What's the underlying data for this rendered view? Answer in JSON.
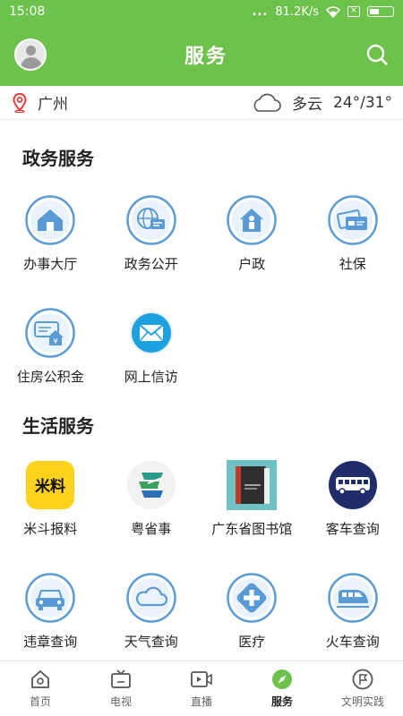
{
  "status_bar": {
    "time": "15:08",
    "dots": "...",
    "speed": "81.2K/s",
    "x_badge": "×"
  },
  "header": {
    "title": "服务"
  },
  "location_bar": {
    "city": "广州",
    "weather": "多云",
    "temperature": "24°/31°"
  },
  "sections": [
    {
      "title": "政务服务",
      "items": [
        {
          "label": "办事大厅",
          "icon": "house-icon"
        },
        {
          "label": "政务公开",
          "icon": "globe-chat-icon"
        },
        {
          "label": "户政",
          "icon": "person-house-icon"
        },
        {
          "label": "社保",
          "icon": "cards-icon"
        },
        {
          "label": "住房公积金",
          "icon": "housing-fund-icon"
        },
        {
          "label": "网上信访",
          "icon": "envelope-icon"
        }
      ]
    },
    {
      "title": "生活服务",
      "items": [
        {
          "label": "米斗报料",
          "icon": "midou-logo-icon"
        },
        {
          "label": "粤省事",
          "icon": "yueshengshi-logo-icon"
        },
        {
          "label": "广东省图书馆",
          "icon": "book-icon"
        },
        {
          "label": "客车查询",
          "icon": "bus-icon"
        },
        {
          "label": "违章查询",
          "icon": "car-icon"
        },
        {
          "label": "天气查询",
          "icon": "cloud-icon"
        },
        {
          "label": "医疗",
          "icon": "medical-cross-icon"
        },
        {
          "label": "火车查询",
          "icon": "train-icon"
        }
      ]
    }
  ],
  "bottom_nav": [
    {
      "label": "首页",
      "icon": "home-icon"
    },
    {
      "label": "电视",
      "icon": "tv-icon"
    },
    {
      "label": "直播",
      "icon": "live-video-icon"
    },
    {
      "label": "服务",
      "icon": "compass-icon",
      "active": true
    },
    {
      "label": "文明实践",
      "icon": "flag-badge-icon"
    }
  ],
  "colors": {
    "brand_green": "#6cc24a",
    "icon_blue": "#5b9bd5",
    "midou_yellow": "#fcd21c",
    "bus_navy": "#1f2d6b"
  }
}
